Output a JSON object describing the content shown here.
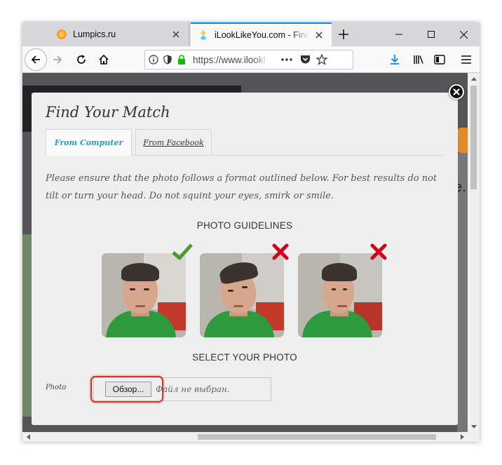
{
  "browser": {
    "tabs": [
      {
        "title": "Lumpics.ru",
        "active": false
      },
      {
        "title": "iLookLikeYou.com - Find m",
        "active": true
      }
    ],
    "url": "https://www.ilookl",
    "accent_color": "#0a84ff"
  },
  "modal": {
    "title": "Find Your Match",
    "tabs": [
      {
        "label": "From Computer",
        "active": true
      },
      {
        "label": "From Facebook",
        "active": false
      }
    ],
    "instructions": "Please ensure that the photo follows a format outlined below. For best results do not tilt or turn your head. Do not squint your eyes, smirk or smile.",
    "guidelines_heading": "PHOTO GUIDELINES",
    "guideline_photos": [
      {
        "status": "correct",
        "icon": "checkmark-icon",
        "color": "#4a9a2c"
      },
      {
        "status": "incorrect",
        "icon": "cross-icon",
        "color": "#d4001a"
      },
      {
        "status": "incorrect",
        "icon": "cross-icon",
        "color": "#d4001a"
      }
    ],
    "select_heading": "SELECT YOUR PHOTO",
    "photo_label": "Photo",
    "file_input": {
      "button_label": "Обзор...",
      "status_text": "Файл не выбран."
    }
  },
  "page_background": {
    "edge_letter": "e."
  }
}
